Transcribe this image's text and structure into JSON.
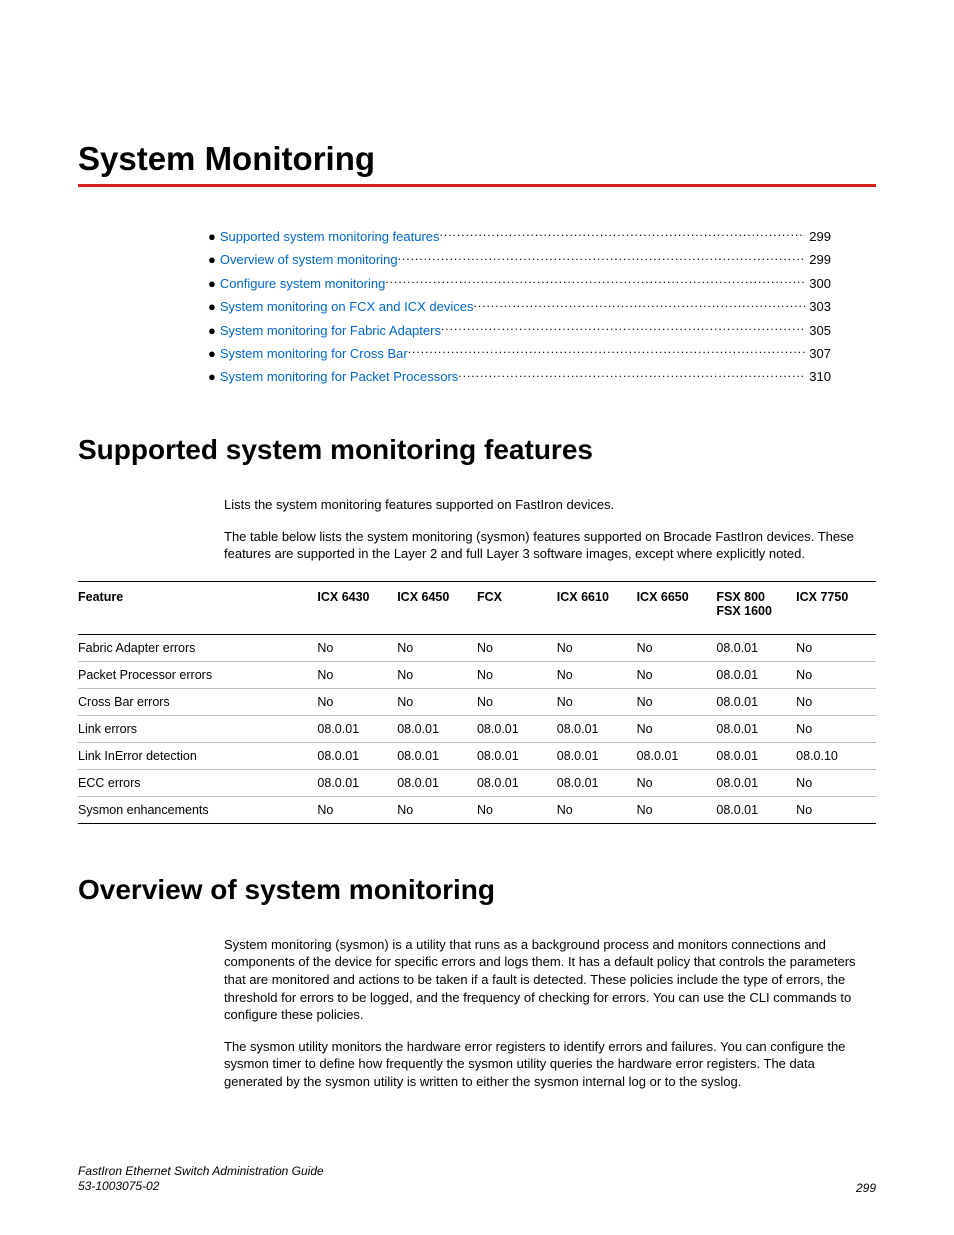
{
  "chapter_title": "System Monitoring",
  "toc": [
    {
      "label": "Supported system monitoring features",
      "page": "299"
    },
    {
      "label": "Overview of system monitoring",
      "page": "299"
    },
    {
      "label": "Configure system monitoring",
      "page": "300"
    },
    {
      "label": "System monitoring on FCX and ICX devices",
      "page": "303"
    },
    {
      "label": "System monitoring for Fabric Adapters",
      "page": "305"
    },
    {
      "label": "System monitoring for Cross Bar",
      "page": "307"
    },
    {
      "label": "System monitoring for Packet Processors",
      "page": "310"
    }
  ],
  "section1": {
    "title": "Supported system monitoring features",
    "intro": "Lists the system monitoring features supported on FastIron devices.",
    "desc": "The table below lists the system monitoring (sysmon) features supported on Brocade FastIron devices. These features are supported in the Layer 2 and full Layer 3 software images, except where explicitly noted."
  },
  "table": {
    "headers": [
      "Feature",
      "ICX 6430",
      "ICX 6450",
      "FCX",
      "ICX 6610",
      "ICX 6650",
      "FSX 800",
      "FSX 1600",
      "ICX 7750"
    ],
    "rows": [
      [
        "Fabric Adapter errors",
        "No",
        "No",
        "No",
        "No",
        "No",
        "08.0.01",
        "No"
      ],
      [
        "Packet Processor errors",
        "No",
        "No",
        "No",
        "No",
        "No",
        "08.0.01",
        "No"
      ],
      [
        "Cross Bar errors",
        "No",
        "No",
        "No",
        "No",
        "No",
        "08.0.01",
        "No"
      ],
      [
        "Link errors",
        "08.0.01",
        "08.0.01",
        "08.0.01",
        "08.0.01",
        "No",
        "08.0.01",
        "No"
      ],
      [
        "Link InError detection",
        "08.0.01",
        "08.0.01",
        "08.0.01",
        "08.0.01",
        "08.0.01",
        "08.0.01",
        "08.0.10"
      ],
      [
        "ECC errors",
        "08.0.01",
        "08.0.01",
        "08.0.01",
        "08.0.01",
        "No",
        "08.0.01",
        "No"
      ],
      [
        "Sysmon enhancements",
        "No",
        "No",
        "No",
        "No",
        "No",
        "08.0.01",
        "No"
      ]
    ]
  },
  "section2": {
    "title": "Overview of system monitoring",
    "p1": "System monitoring (sysmon) is a utility that runs as a background process and monitors connections and components of the device for specific errors and logs them. It has a default policy that controls the parameters that are monitored and actions to be taken if a fault is detected. These policies include the type of errors, the threshold for errors to be logged, and the frequency of checking for errors. You can use the CLI commands to configure these policies.",
    "p2": "The sysmon utility monitors the hardware error registers to identify errors and failures. You can configure the sysmon timer to define how frequently the sysmon utility queries the hardware error registers. The data generated by the sysmon utility is written to either the sysmon internal log or to the syslog."
  },
  "footer": {
    "guide": "FastIron Ethernet Switch Administration Guide",
    "docnum": "53-1003075-02",
    "page": "299"
  }
}
